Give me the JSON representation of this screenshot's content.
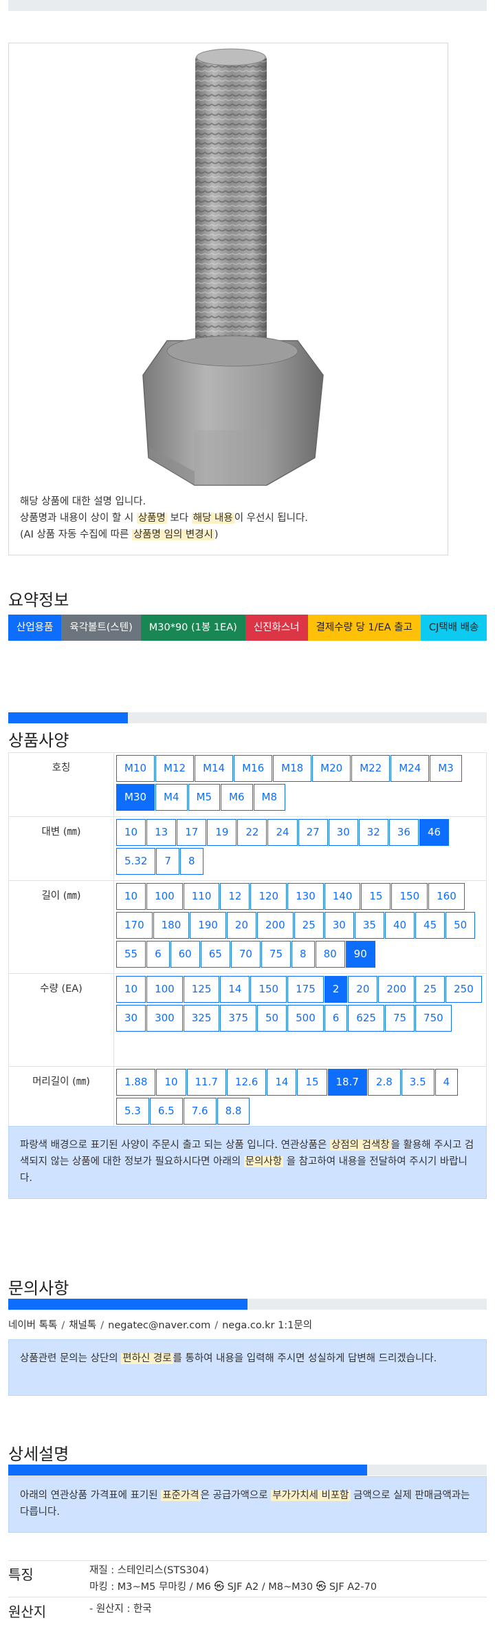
{
  "product": {
    "description": {
      "line1": "해당 상품에 대한 설명 입니다.",
      "line2_a": "상품명과 내용이 상이 할 시 ",
      "line2_hl1": "상품명",
      "line2_b": " 보다 ",
      "line2_hl2": "해당 내용",
      "line2_c": "이 우선시 됩니다.",
      "line3_a": "(AI 상품 자동 수집에 따른 ",
      "line3_hl": "상품명 임의 변경시",
      "line3_b": ")"
    }
  },
  "summary": {
    "title": "요약정보",
    "badges": [
      {
        "label": "산업용품",
        "color": "#0d6efd",
        "text_color": "#ffffff"
      },
      {
        "label": "육각볼트(스텐)",
        "color": "#6c757d",
        "text_color": "#ffffff"
      },
      {
        "label": "M30*90 (1봉 1EA)",
        "color": "#198754",
        "text_color": "#ffffff"
      },
      {
        "label": "신진화스너",
        "color": "#dc3545",
        "text_color": "#ffffff"
      },
      {
        "label": "결제수량 당 1/EA 출고",
        "color": "#ffc107",
        "text_color": "#222222"
      },
      {
        "label": "CJ택배 배송",
        "color": "#0dcaf0",
        "text_color": "#222222"
      }
    ]
  },
  "spec": {
    "title": "상품사양",
    "progress": 0.25,
    "rows": [
      {
        "label": "호칭",
        "options": [
          "M10",
          "M12",
          "M14",
          "M16",
          "M18",
          "M20",
          "M22",
          "M24",
          "M3",
          "M30",
          "M4",
          "M5",
          "M6",
          "M8"
        ],
        "selected": "M30"
      },
      {
        "label": "대변 (㎜)",
        "options": [
          "10",
          "13",
          "17",
          "19",
          "22",
          "24",
          "27",
          "30",
          "32",
          "36",
          "46",
          "5.32",
          "7",
          "8"
        ],
        "selected": "46"
      },
      {
        "label": "길이 (㎜)",
        "options": [
          "10",
          "100",
          "110",
          "12",
          "120",
          "130",
          "140",
          "15",
          "150",
          "160",
          "170",
          "180",
          "190",
          "20",
          "200",
          "25",
          "30",
          "35",
          "40",
          "45",
          "50",
          "55",
          "6",
          "60",
          "65",
          "70",
          "75",
          "8",
          "80",
          "90"
        ],
        "selected": "90"
      },
      {
        "label": "수량 (EA)",
        "options": [
          "10",
          "100",
          "125",
          "14",
          "150",
          "175",
          "2",
          "20",
          "200",
          "25",
          "250",
          "30",
          "300",
          "325",
          "375",
          "50",
          "500",
          "6",
          "625",
          "75",
          "750"
        ],
        "selected": "2"
      },
      {
        "label": "머리길이 (㎜)",
        "options": [
          "1.88",
          "10",
          "11.7",
          "12.6",
          "14",
          "15",
          "18.7",
          "2.8",
          "3.5",
          "4",
          "5.3",
          "6.5",
          "7.6",
          "8.8"
        ],
        "selected": "18.7"
      }
    ],
    "notice": {
      "a": "파랑색 배경으로 표기된 사양이 주문시 출고 되는 상품 입니다. 연관상품은 ",
      "hl1": "상점의 검색창",
      "b": "을 활용해 주시고 검색되지 않는 상품에 대한 정보가 필요하시다면 아래의 ",
      "hl2": "문의사항",
      "c": " 을 참고하여 내용을 전달하여 주시기 바랍니다."
    }
  },
  "inquiry": {
    "title": "문의사항",
    "progress": 0.5,
    "links": [
      "네이버 톡톡",
      "채널톡",
      "negatec@naver.com",
      "nega.co.kr 1:1문의"
    ],
    "link_separator": "/",
    "notice": {
      "a": "상품관련 문의는 상단의 ",
      "hl": "편하신 경로",
      "b": "를 통하여 내용을 입력해 주시면 성실하게 답변해 드리겠습니다."
    }
  },
  "detail": {
    "title": "상세설명",
    "progress": 0.75,
    "notice": {
      "a": "아래의 연관상품 가격표에 표기된 ",
      "hl1": "표준가격",
      "b": "은 공급가액으로 ",
      "hl2": "부가가치세 비포함",
      "c": " 금액으로 실제 판매금액과는 다릅니다."
    },
    "features_label": "특징",
    "features": [
      "재질 : 스테인리스(STS304)",
      "마킹 : M3~M5 무마킹 / M6 ㉿ SJF A2 / M8~M30 ㉿ SJF A2-70"
    ],
    "origin_label": "원산지",
    "origin": "- 원산지 : 한국"
  }
}
